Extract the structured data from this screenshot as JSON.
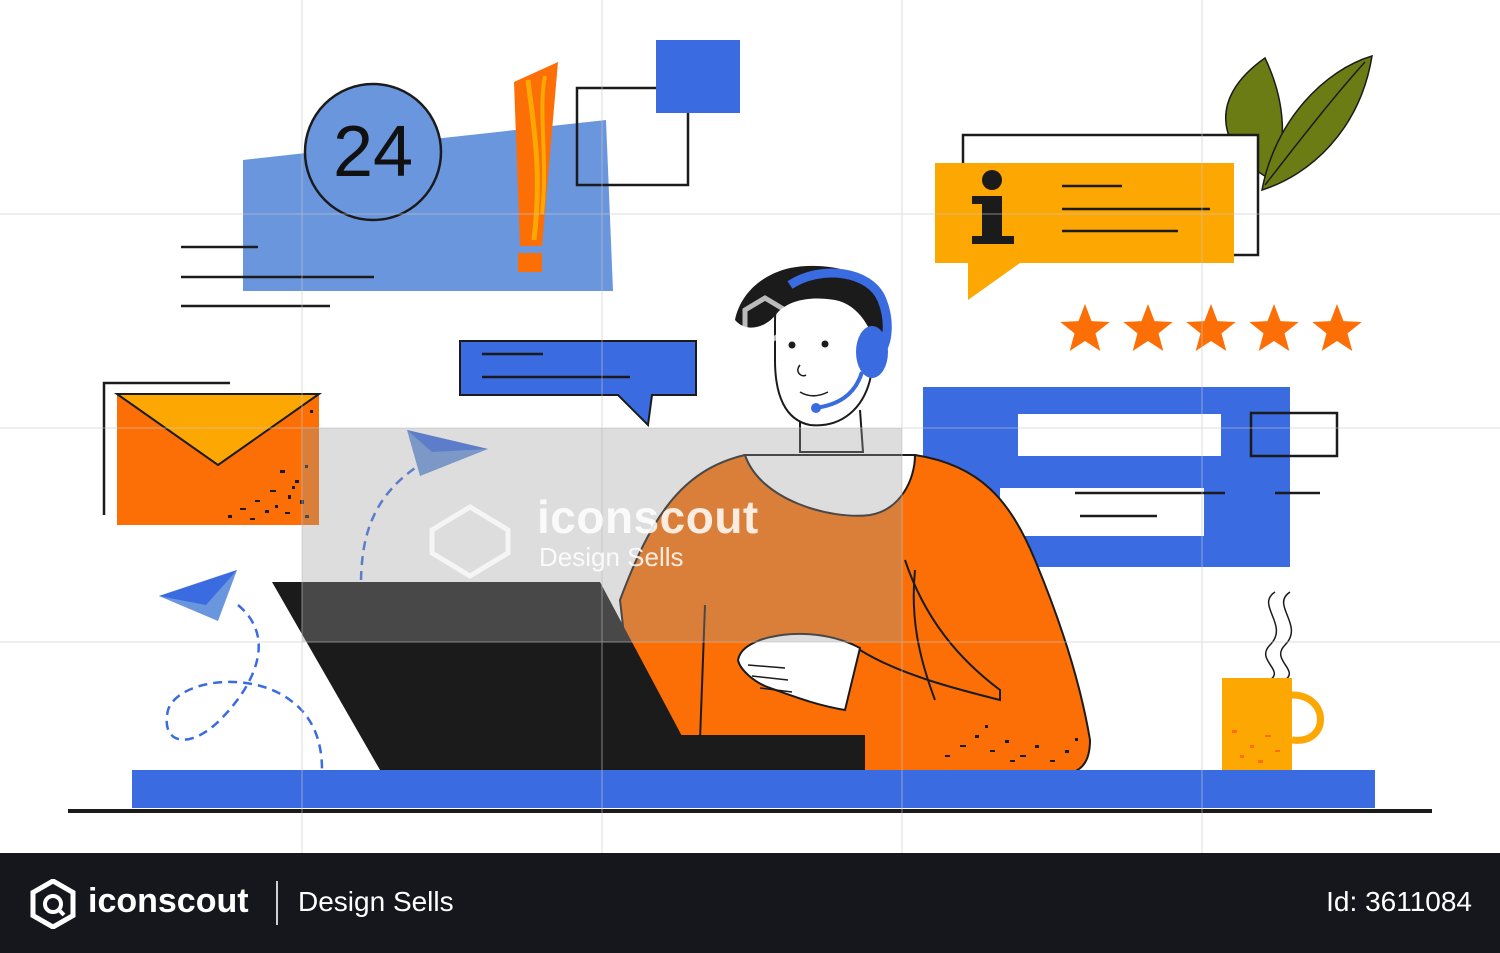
{
  "badge_24": {
    "text": "24"
  },
  "watermark": {
    "brand": "iconscout",
    "tagline": "Design Sells"
  },
  "footer": {
    "brand": "iconscout",
    "tagline": "Design Sells",
    "id_text": "Id: 3611084"
  },
  "rating": {
    "stars": 5,
    "max": 5
  },
  "colors": {
    "blue": "#3b6be0",
    "light_blue": "#6a96dd",
    "orange": "#fb6f06",
    "yellow": "#fda702",
    "black": "#1b1b1b",
    "leaf_green": "#6c7c14",
    "footer_bg": "#15171d"
  },
  "icons": [
    "24-hour-badge-icon",
    "exclamation-icon",
    "info-icon",
    "star-icon",
    "envelope-icon",
    "paper-plane-icon",
    "headset-icon",
    "laptop-icon",
    "coffee-mug-icon",
    "leaf-icon",
    "iconscout-logo-icon"
  ]
}
